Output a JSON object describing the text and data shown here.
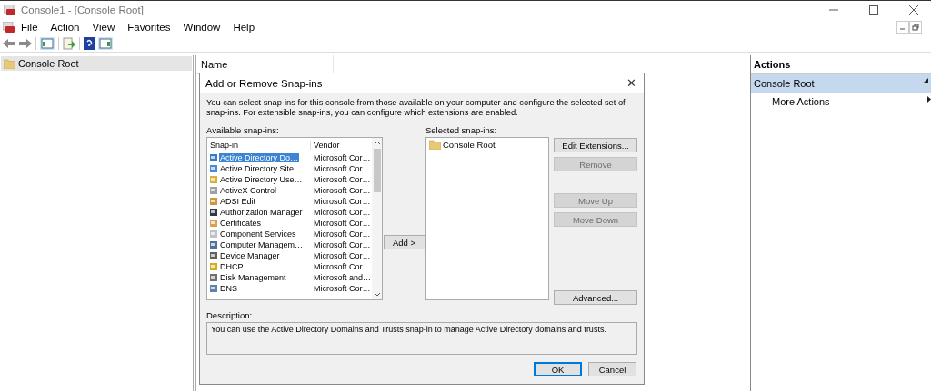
{
  "window": {
    "title": "Console1 - [Console Root]"
  },
  "menu": [
    "File",
    "Action",
    "View",
    "Favorites",
    "Window",
    "Help"
  ],
  "tree": [
    {
      "label": "Console Root",
      "selected": true
    }
  ],
  "middle": {
    "column": "Name"
  },
  "actions": {
    "title": "Actions",
    "section": "Console Root",
    "items": [
      "More Actions"
    ]
  },
  "dialog": {
    "title": "Add or Remove Snap-ins",
    "close": "✕",
    "intro": "You can select snap-ins for this console from those available on your computer and configure the selected set of snap-ins. For extensible snap-ins, you can configure which extensions are enabled.",
    "available_label": "Available snap-ins:",
    "columns": [
      "Snap-in",
      "Vendor"
    ],
    "available": [
      {
        "name": "Active Directory Do…",
        "vendor": "Microsoft Cor…",
        "selected": true
      },
      {
        "name": "Active Directory Site…",
        "vendor": "Microsoft Cor…",
        "selected": false
      },
      {
        "name": "Active Directory Use…",
        "vendor": "Microsoft Cor…",
        "selected": false
      },
      {
        "name": "ActiveX Control",
        "vendor": "Microsoft Cor…",
        "selected": false
      },
      {
        "name": "ADSI Edit",
        "vendor": "Microsoft Cor…",
        "selected": false
      },
      {
        "name": "Authorization Manager",
        "vendor": "Microsoft Cor…",
        "selected": false
      },
      {
        "name": "Certificates",
        "vendor": "Microsoft Cor…",
        "selected": false
      },
      {
        "name": "Component Services",
        "vendor": "Microsoft Cor…",
        "selected": false
      },
      {
        "name": "Computer Managem…",
        "vendor": "Microsoft Cor…",
        "selected": false
      },
      {
        "name": "Device Manager",
        "vendor": "Microsoft Cor…",
        "selected": false
      },
      {
        "name": "DHCP",
        "vendor": "Microsoft Cor…",
        "selected": false
      },
      {
        "name": "Disk Management",
        "vendor": "Microsoft and…",
        "selected": false
      },
      {
        "name": "DNS",
        "vendor": "Microsoft Cor…",
        "selected": false
      }
    ],
    "add_button": "Add >",
    "selected_label": "Selected snap-ins:",
    "selected": [
      {
        "name": "Console Root",
        "selected": false
      }
    ],
    "side_buttons": [
      {
        "label": "Edit Extensions...",
        "disabled": false
      },
      {
        "label": "Remove",
        "disabled": true
      },
      {
        "label": "Move Up",
        "disabled": true
      },
      {
        "label": "Move Down",
        "disabled": true
      },
      {
        "label": "Advanced...",
        "disabled": false
      }
    ],
    "description_label": "Description:",
    "description": "You can use the Active Directory Domains and Trusts snap-in to manage Active Directory domains and trusts.",
    "buttons": [
      {
        "label": "OK",
        "default": true
      },
      {
        "label": "Cancel",
        "default": false
      }
    ]
  }
}
